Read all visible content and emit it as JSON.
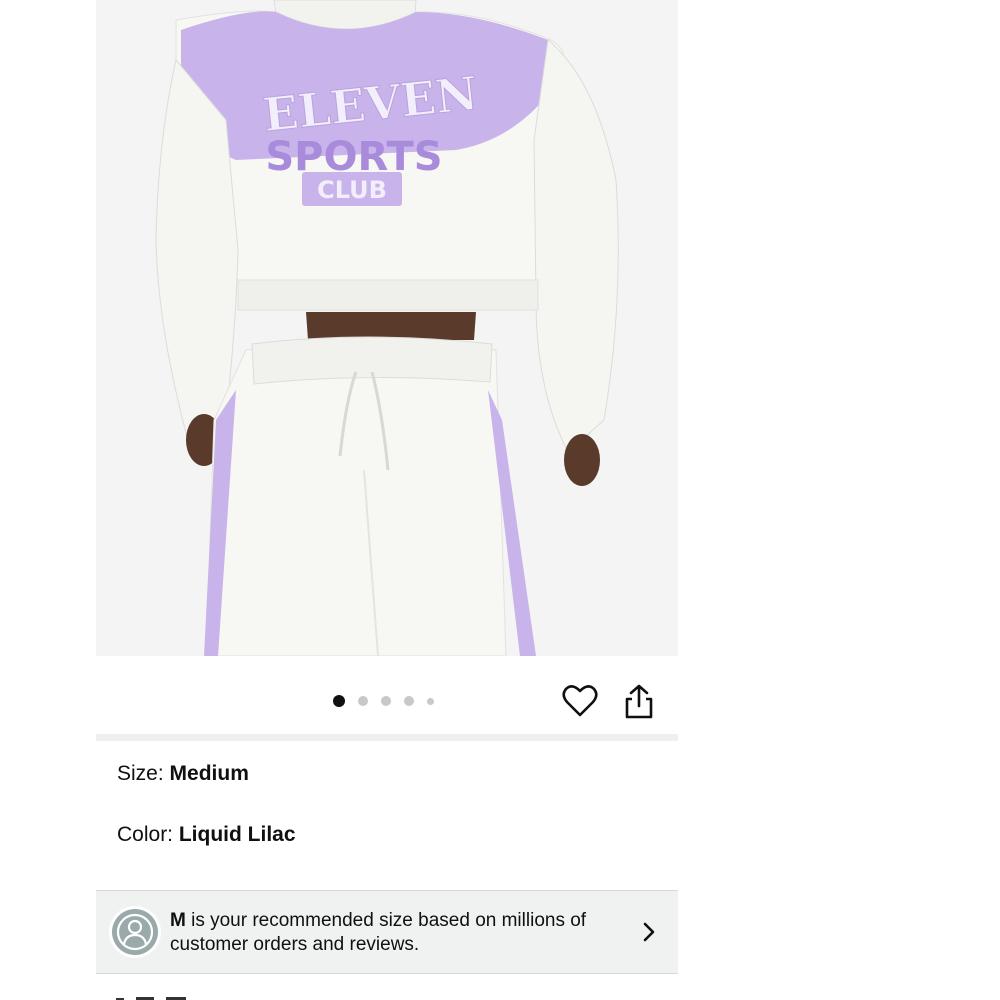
{
  "product": {
    "image": {
      "icon": "product-photo",
      "garment_text": {
        "line1": "ELEVEN",
        "line2": "SPORTS",
        "line3": "CLUB"
      },
      "colors": {
        "lilac": "#c8b3ea",
        "lilac_dark": "#a98bdc",
        "white": "#f7f7f3",
        "background": "#f4f4f4",
        "skin": "#5a3a2a"
      }
    },
    "carousel": {
      "count": 5,
      "active_index": 0
    },
    "actions": {
      "wishlist_icon": "heart-outline-icon",
      "share_icon": "share-icon"
    },
    "size": {
      "label": "Size: ",
      "value": "Medium"
    },
    "color": {
      "label": "Color: ",
      "value": "Liquid Lilac"
    },
    "recommendation": {
      "size": "M",
      "text": " is your recommended size based on millions of customer orders and reviews.",
      "avatar_icon": "user-avatar-icon",
      "chevron_icon": "chevron-right-icon"
    }
  }
}
